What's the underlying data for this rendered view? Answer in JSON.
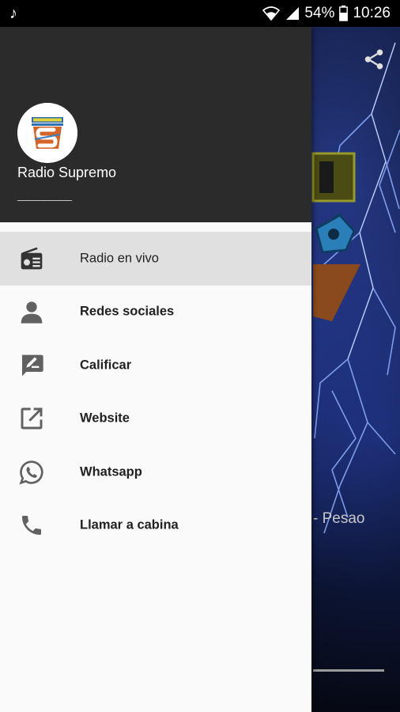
{
  "status_bar": {
    "battery": "54%",
    "time": "10:26"
  },
  "drawer": {
    "station_name": "Radio Supremo",
    "station_subtitle": "__________",
    "menu": [
      {
        "label": "Radio en vivo",
        "icon": "radio-icon",
        "active": true
      },
      {
        "label": "Redes sociales",
        "icon": "person-icon"
      },
      {
        "label": "Calificar",
        "icon": "rate-review-icon"
      },
      {
        "label": "Website",
        "icon": "open-in-new-icon"
      },
      {
        "label": "Whatsapp",
        "icon": "whatsapp-icon"
      },
      {
        "label": "Llamar a cabina",
        "icon": "phone-icon"
      }
    ]
  },
  "background": {
    "now_playing_fragment": "- Pesao"
  },
  "colors": {
    "drawer_header": "#2b2b2b",
    "drawer_body": "#fafafa",
    "active_item": "#e0e0e0",
    "icon": "#616161",
    "text": "#212121"
  }
}
